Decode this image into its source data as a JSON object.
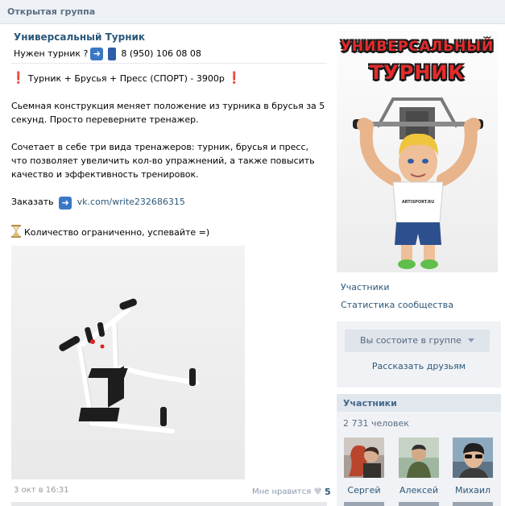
{
  "page": {
    "section_title": "Открытая группа"
  },
  "post": {
    "group_name": "Универсальный Турник",
    "subtitle_prefix": "Нужен турник ?",
    "phone": "8 (950) 106 08 08",
    "headline_mark": "❗",
    "headline": " Турник + Брусья + Пресс (СПОРТ) - 3900р ",
    "para1": "Сьемная конструкция меняет положение из турника в брусья за 5 секунд. Просто переверните тренажер.",
    "para2": "Сочетает в себе три вида тренажеров: турник, брусья и пресс, что позволяет увеличить кол-во упражнений, а также повысить качество и эффективность тренировок.",
    "order_label": "Заказать",
    "order_link": "vk.com/write232686315",
    "limited": "Количество ограниченно, успевайте =)",
    "date": "3 окт в 16:31",
    "likes_label": "Мне нравится",
    "likes_count": "5"
  },
  "sidebar": {
    "banner_line1": "УНИВЕРСАЛЬНЫЙ",
    "banner_line2": "ТУРНИК",
    "banner_shirt": "ARTISPORT.RU",
    "links": [
      "Участники",
      "Статистика сообщества"
    ],
    "join_button": "Вы состоите в группе",
    "tell_friends": "Рассказать друзьям",
    "members_title": "Участники",
    "members_count": "2 731 человек",
    "members": [
      {
        "name": "Сергей"
      },
      {
        "name": "Алексей"
      },
      {
        "name": "Михаил"
      }
    ]
  },
  "colors": {
    "link": "#2b587a",
    "header_bg": "#edf1f5",
    "accent_red": "#e52b2b"
  }
}
